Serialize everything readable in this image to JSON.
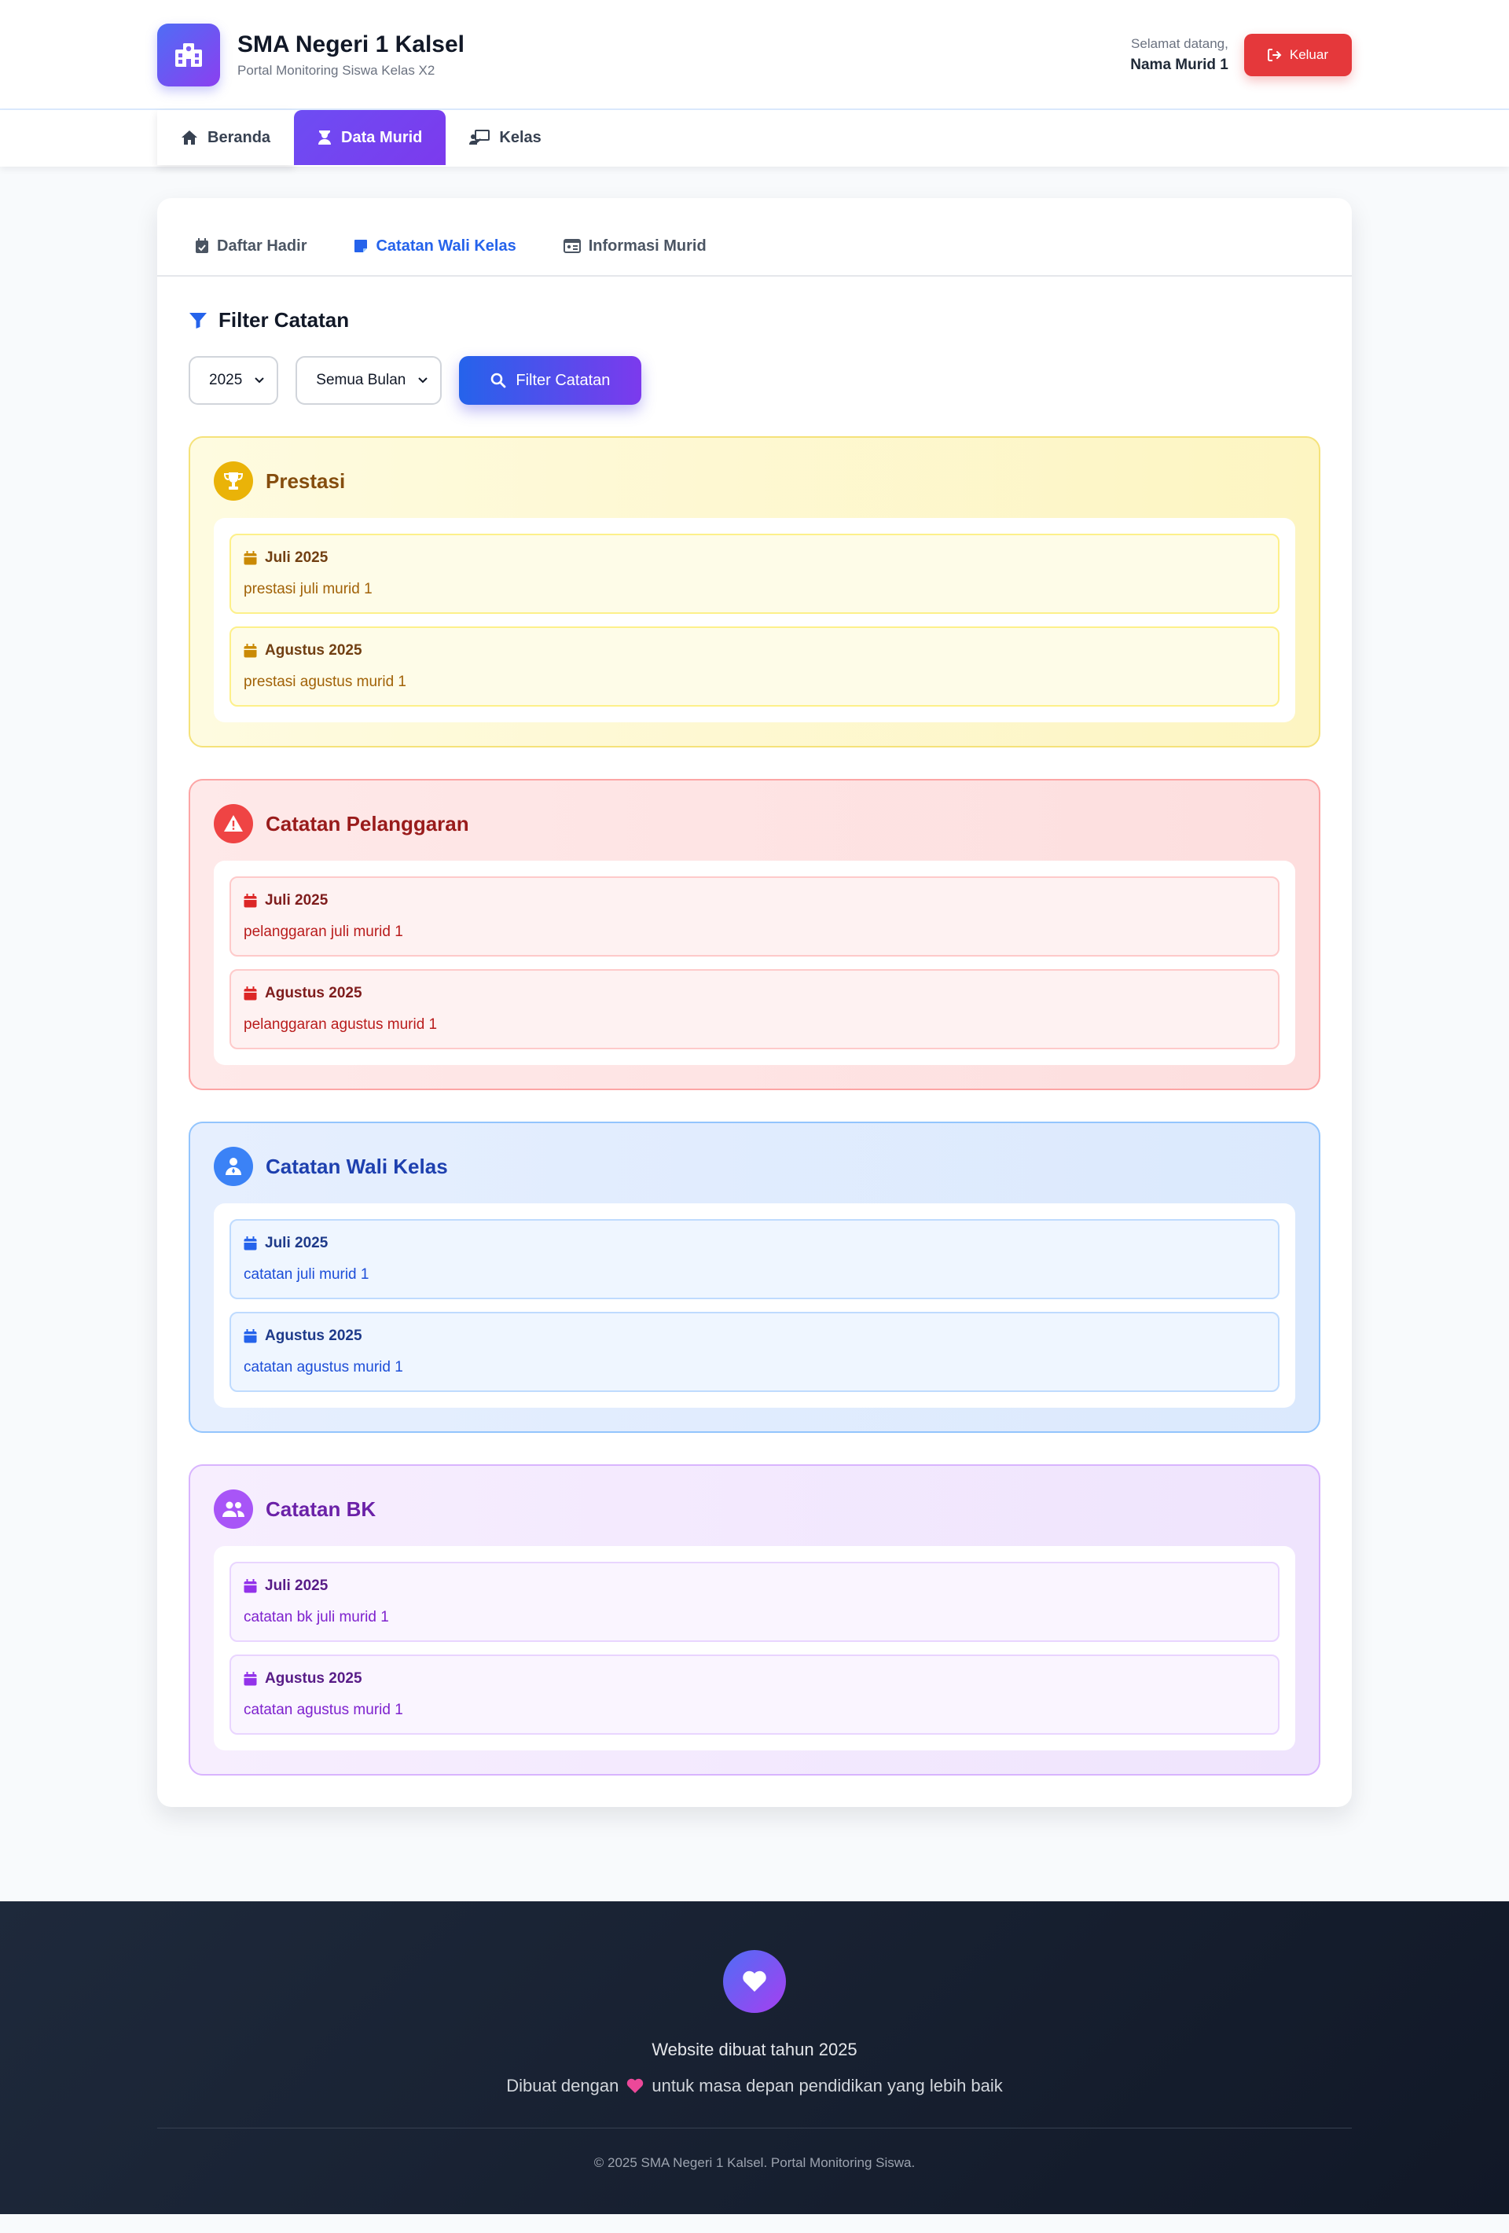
{
  "header": {
    "school_name": "SMA Negeri 1 Kalsel",
    "subtitle": "Portal Monitoring Siswa Kelas X2",
    "welcome_label": "Selamat datang,",
    "user_name": "Nama Murid 1",
    "logout_label": "Keluar"
  },
  "nav": {
    "items": [
      {
        "label": "Beranda",
        "icon": "home-icon"
      },
      {
        "label": "Data Murid",
        "icon": "student-icon",
        "active": true
      },
      {
        "label": "Kelas",
        "icon": "classroom-icon"
      }
    ]
  },
  "tabs": [
    {
      "label": "Daftar Hadir",
      "icon": "calendar-check-icon"
    },
    {
      "label": "Catatan Wali Kelas",
      "icon": "sticky-note-icon",
      "active": true
    },
    {
      "label": "Informasi Murid",
      "icon": "id-card-icon"
    }
  ],
  "filter": {
    "title": "Filter Catatan",
    "year_value": "2025",
    "month_value": "Semua Bulan",
    "button_label": "Filter Catatan"
  },
  "sections": {
    "prestasi": {
      "title": "Prestasi",
      "notes": [
        {
          "date": "Juli 2025",
          "text": "prestasi juli murid 1"
        },
        {
          "date": "Agustus 2025",
          "text": "prestasi agustus murid 1"
        }
      ]
    },
    "pelanggaran": {
      "title": "Catatan Pelanggaran",
      "notes": [
        {
          "date": "Juli 2025",
          "text": "pelanggaran juli murid 1"
        },
        {
          "date": "Agustus 2025",
          "text": "pelanggaran agustus murid 1"
        }
      ]
    },
    "walikelas": {
      "title": "Catatan Wali Kelas",
      "notes": [
        {
          "date": "Juli 2025",
          "text": "catatan juli murid 1"
        },
        {
          "date": "Agustus 2025",
          "text": "catatan agustus murid 1"
        }
      ]
    },
    "bk": {
      "title": "Catatan BK",
      "notes": [
        {
          "date": "Juli 2025",
          "text": "catatan bk juli murid 1"
        },
        {
          "date": "Agustus 2025",
          "text": "catatan agustus murid 1"
        }
      ]
    }
  },
  "footer": {
    "line1": "Website dibuat tahun 2025",
    "line2_before": "Dibuat dengan",
    "line2_after": "untuk masa depan pendidikan yang lebih baik",
    "copyright": "© 2025 SMA Negeri 1 Kalsel. Portal Monitoring Siswa."
  },
  "colors": {
    "primary": "#2563eb",
    "accent": "#7c3aed",
    "logout": "#e5383b",
    "prestasi": "#eab308",
    "pelanggaran": "#ef4444",
    "walikelas": "#3b82f6",
    "bk": "#a855f7"
  }
}
